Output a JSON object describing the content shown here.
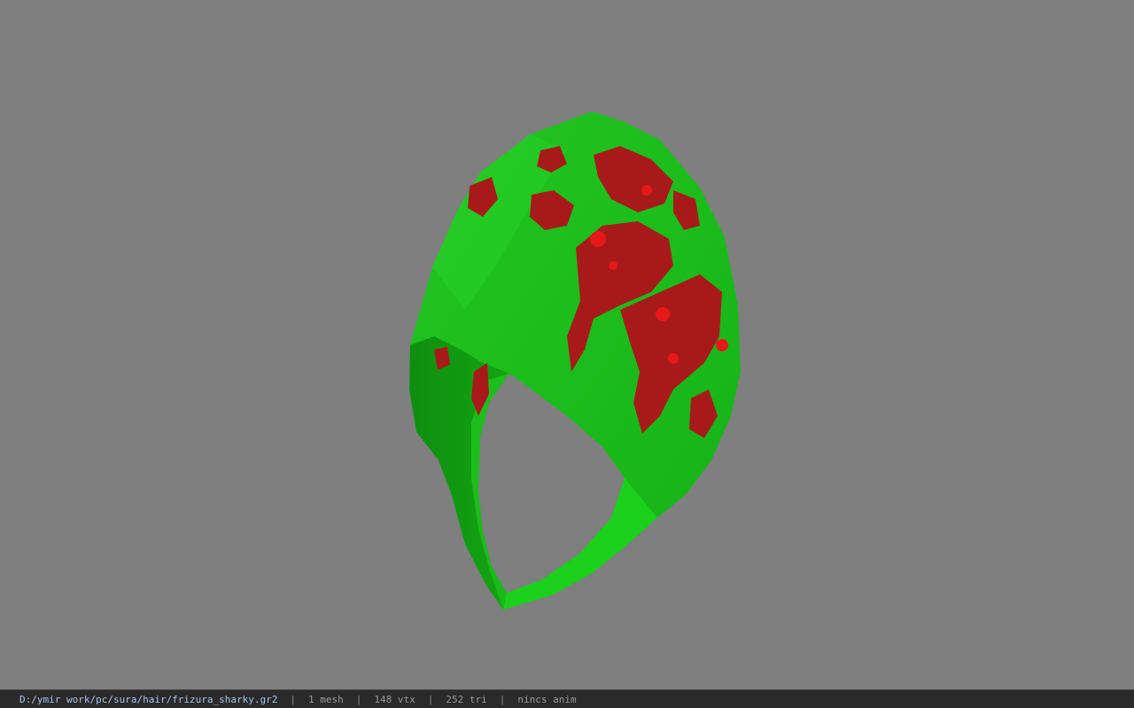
{
  "viewport": {
    "background_color": "#7f7f7f",
    "model": {
      "name": "frizura_sharky",
      "base_color": "#1fc21f",
      "pattern_color": "#a81a1a"
    }
  },
  "status_bar": {
    "file_path": "D:/ymir work/pc/sura/hair/frizura_sharky.gr2",
    "separator": "|",
    "mesh_count": "1 mesh",
    "vertex_count": "148 vtx",
    "triangle_count": "252 tri",
    "anim_status": "nincs anim",
    "path_color": "#a9c4ea"
  }
}
